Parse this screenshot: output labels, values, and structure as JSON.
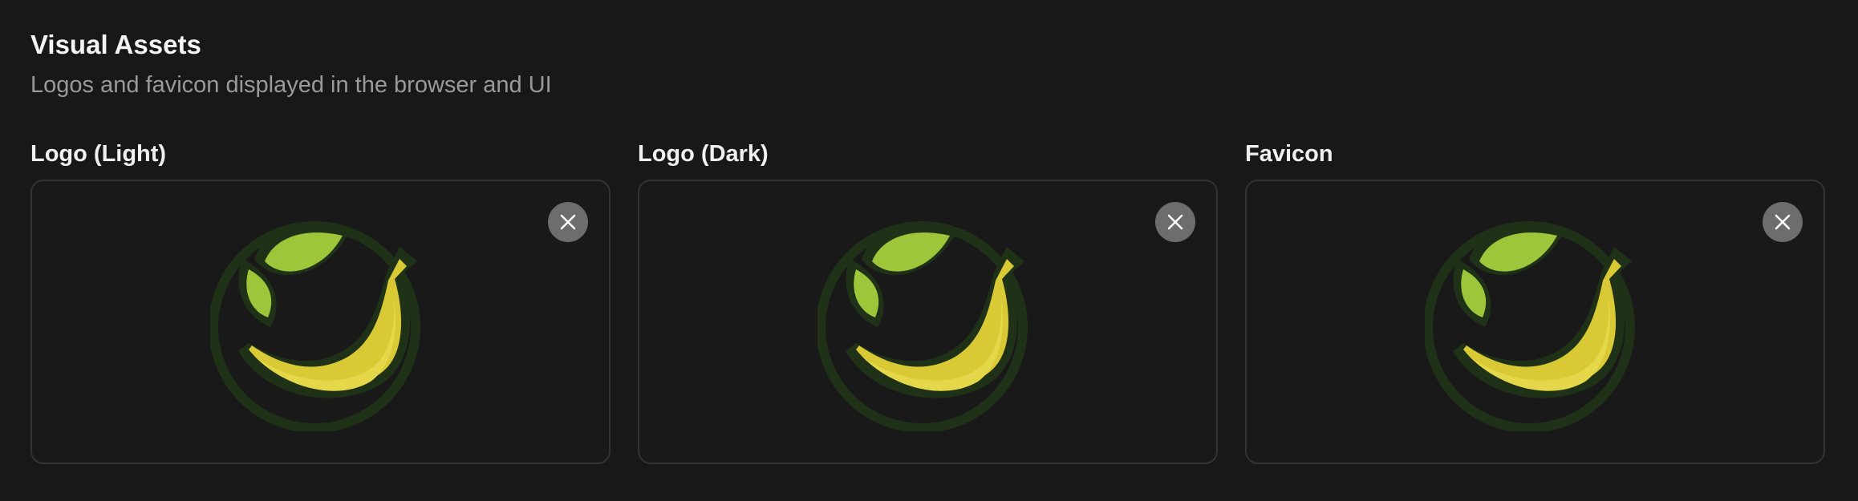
{
  "section": {
    "title": "Visual Assets",
    "subtitle": "Logos and favicon displayed in the browser and UI"
  },
  "assets": [
    {
      "label": "Logo (Light)",
      "icon": "banana-leaf-logo",
      "action_icon": "close-icon"
    },
    {
      "label": "Logo (Dark)",
      "icon": "banana-leaf-logo",
      "action_icon": "close-icon"
    },
    {
      "label": "Favicon",
      "icon": "banana-leaf-logo",
      "action_icon": "close-icon"
    }
  ],
  "colors": {
    "background": "#181818",
    "border": "#333333",
    "remove_button": "#6d6d6d",
    "logo_outline": "#1f3218",
    "leaf": "#9dc63b",
    "banana": "#d8c935"
  }
}
